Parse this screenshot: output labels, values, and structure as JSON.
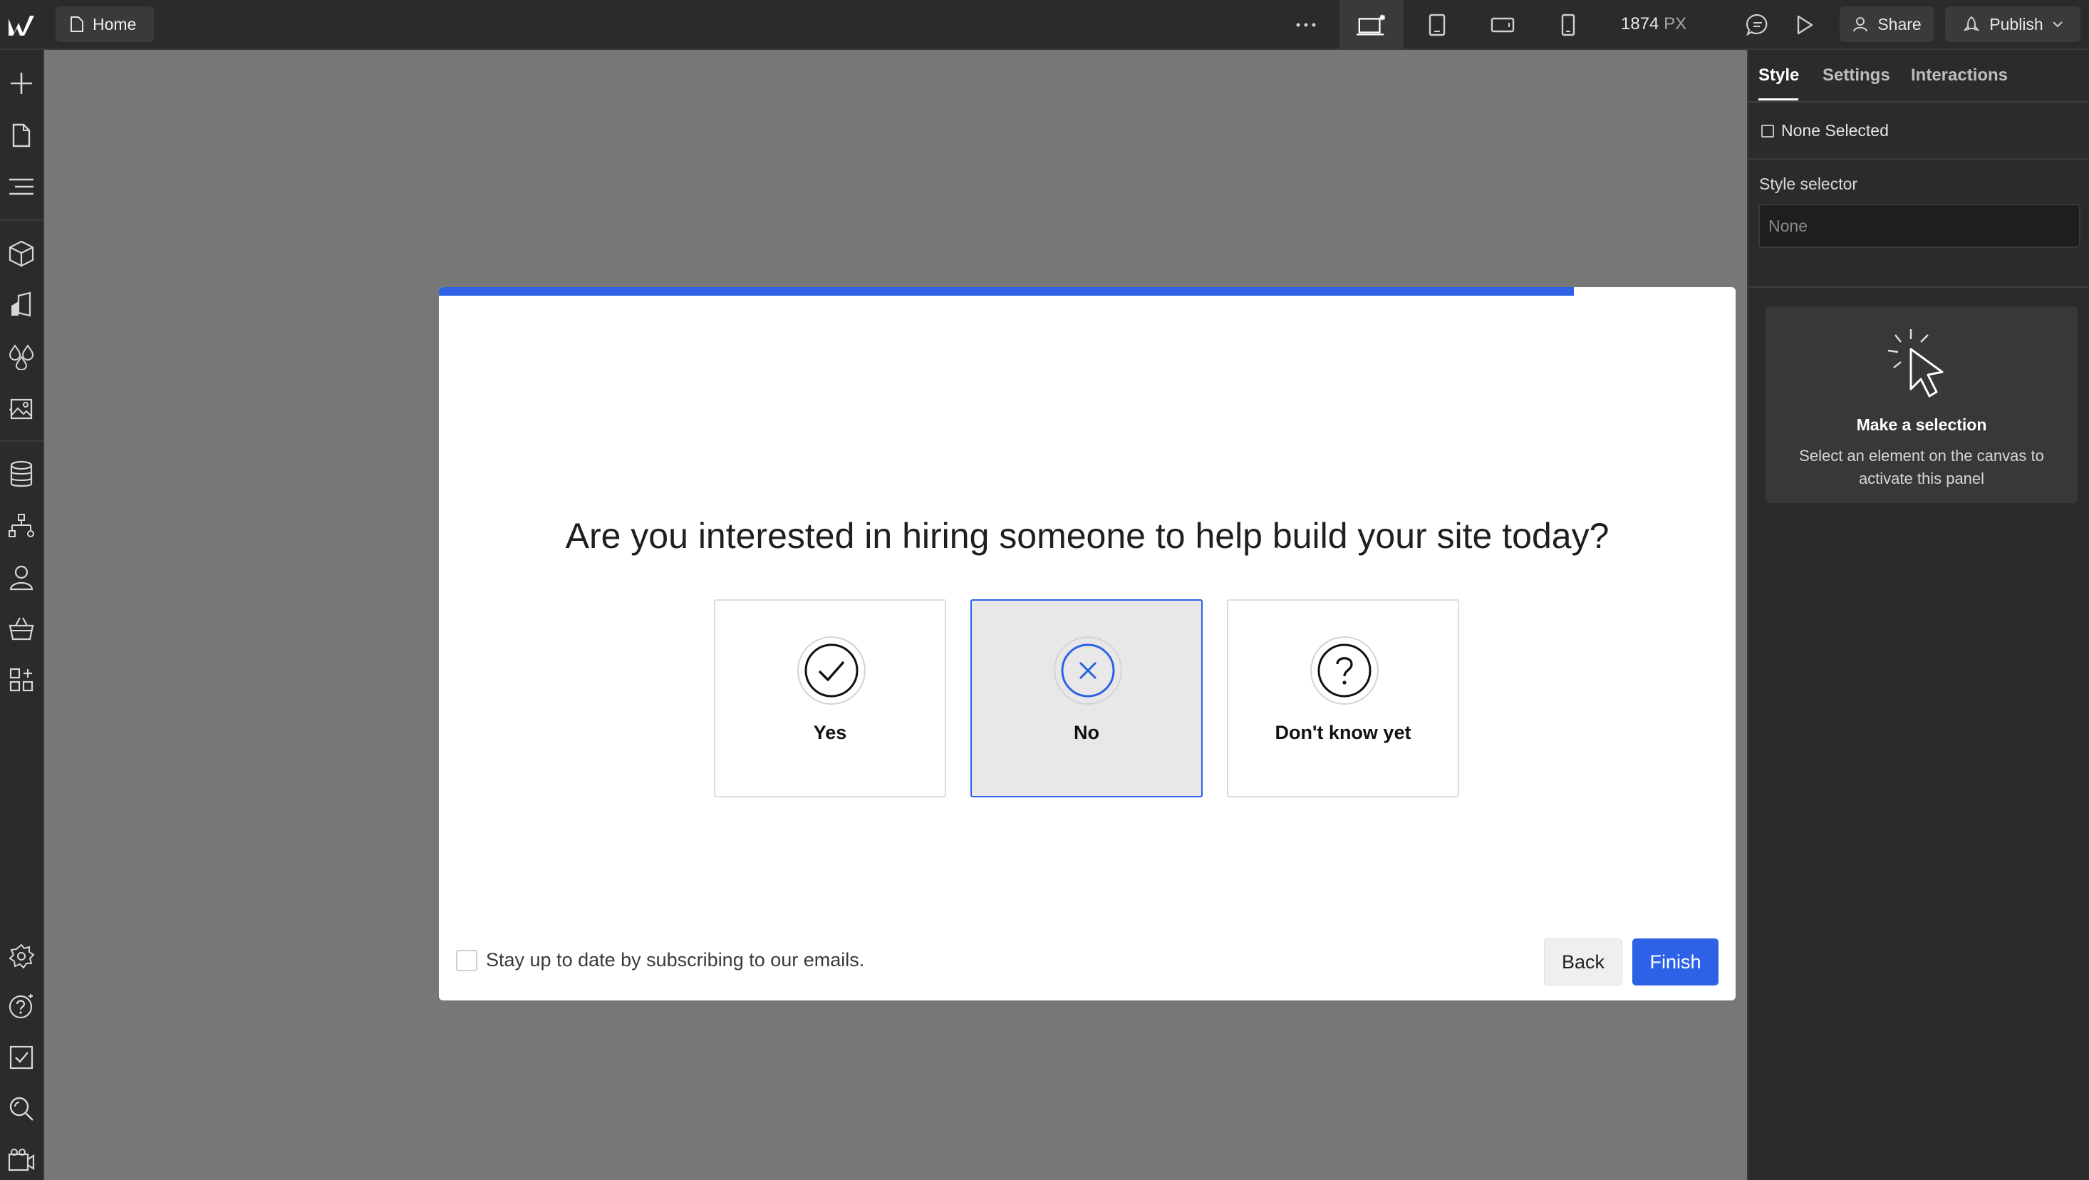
{
  "topbar": {
    "page_name": "Home",
    "canvas_width_value": "1874",
    "canvas_width_unit": "PX",
    "share_label": "Share",
    "publish_label": "Publish"
  },
  "icons": {
    "left_sidebar": [
      "add-icon",
      "pages-icon",
      "navigator-icon",
      "components-icon",
      "style-manager-icon",
      "variables-icon",
      "assets-icon",
      "cms-icon",
      "logic-icon",
      "users-icon",
      "ecommerce-icon",
      "apps-icon",
      "settings-icon",
      "help-icon",
      "audit-icon",
      "search-icon",
      "video-icon"
    ]
  },
  "modal": {
    "progress_percent": 87.5,
    "question": "Are you interested in hiring someone to help build your site today?",
    "options": [
      {
        "label": "Yes",
        "icon": "check-icon",
        "selected": false
      },
      {
        "label": "No",
        "icon": "x-icon",
        "selected": true
      },
      {
        "label": "Don't know yet",
        "icon": "question-icon",
        "selected": false
      }
    ],
    "subscribe_label": "Stay up to date by subscribing to our emails.",
    "back_label": "Back",
    "finish_label": "Finish"
  },
  "panel": {
    "tabs": [
      "Style",
      "Settings",
      "Interactions"
    ],
    "active_tab": "Style",
    "none_selected": "None Selected",
    "style_selector_label": "Style selector",
    "style_selector_placeholder": "None",
    "empty_title": "Make a selection",
    "empty_desc": "Select an element on the canvas to activate this panel"
  },
  "colors": {
    "accent": "#2d62e6",
    "canvas": "#777777",
    "chrome": "#2b2b2b"
  }
}
